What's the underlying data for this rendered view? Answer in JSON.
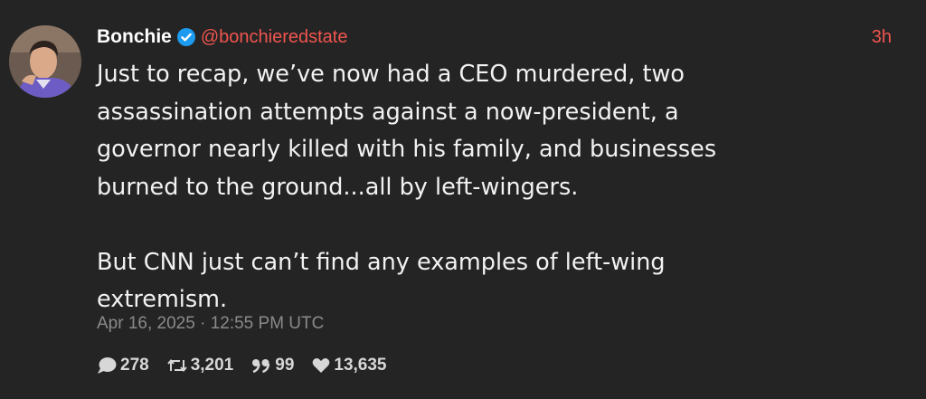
{
  "post": {
    "author_name": "Bonchie",
    "handle": "@bonchieredstate",
    "time_ago": "3h",
    "body_lines": [
      "Just to recap, we’ve now had a CEO murdered, two",
      "assassination attempts against a now-president, a",
      "governor nearly killed with his family, and businesses",
      "burned to the ground...all by left-wingers.",
      "But CNN just can’t find any examples of left-wing",
      "extremism."
    ],
    "timestamp": "Apr 16, 2025 · 12:55 PM UTC"
  },
  "stats": {
    "replies": "278",
    "reposts": "3,201",
    "quotes": "99",
    "likes": "13,635"
  },
  "icons": {
    "verified": "verified-badge-icon",
    "reply": "speech-bubble-icon",
    "repost": "repost-arrows-icon",
    "quote": "quote-marks-icon",
    "like": "heart-icon"
  },
  "colors": {
    "background": "#242424",
    "text": "#f2f2f2",
    "handle": "#f0554f",
    "meta": "#8a8a8a",
    "verified": "#1d9bf0"
  }
}
